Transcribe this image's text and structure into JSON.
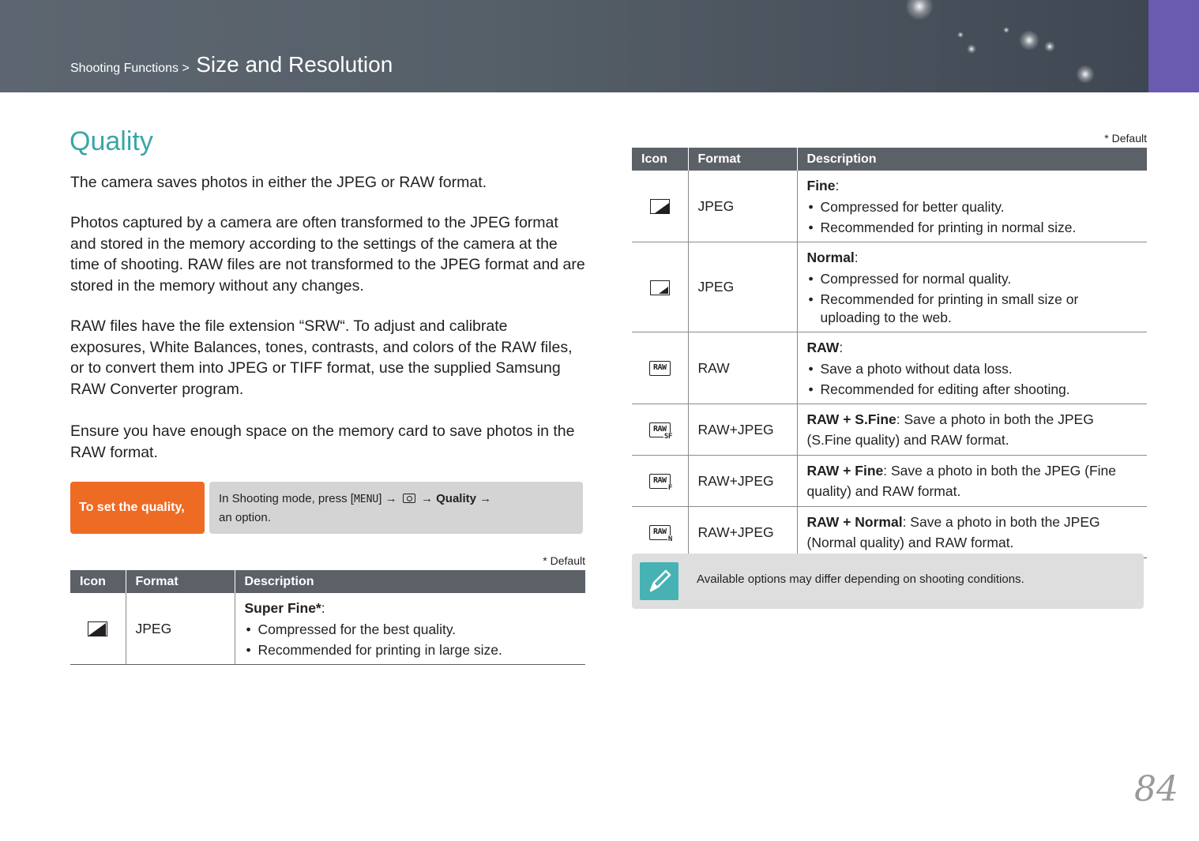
{
  "header": {
    "breadcrumb_parent": "Shooting Functions",
    "breadcrumb_sep": ">",
    "breadcrumb_current": "Size and Resolution"
  },
  "section": {
    "title": "Quality",
    "paragraphs": [
      "The camera saves photos in either the JPEG or RAW format.",
      "Photos captured by a camera are often transformed to the JPEG format and stored in the memory according to the settings of the camera at the time of shooting. RAW files are not transformed to the JPEG format and are stored in the memory without any changes.",
      "RAW files have the file extension “SRW“. To adjust and calibrate exposures, White Balances, tones, contrasts, and colors of the RAW files, or to convert them into JPEG or TIFF format, use the supplied Samsung RAW Converter program.",
      "Ensure you have enough space on the memory card to save photos in the RAW format."
    ]
  },
  "howto": {
    "label": "To set the quality,",
    "instr_prefix": "In Shooting mode, press [",
    "menu_key": "MENU",
    "instr_mid": "] →",
    "arrow2": "→",
    "quality": "Quality",
    "arrow3": "→",
    "instr_end": "an option."
  },
  "default_note": "* Default",
  "table_headers": {
    "icon": "Icon",
    "format": "Format",
    "description": "Description"
  },
  "table_left": [
    {
      "icon": "super-fine-icon",
      "format": "JPEG",
      "name": "Super Fine*",
      "bullets": [
        "Compressed for the best quality.",
        "Recommended for printing in large size."
      ]
    }
  ],
  "table_right": [
    {
      "icon": "fine-icon",
      "format": "JPEG",
      "name": "Fine",
      "bullets": [
        "Compressed for better quality.",
        "Recommended for printing in normal size."
      ]
    },
    {
      "icon": "normal-icon",
      "format": "JPEG",
      "name": "Normal",
      "bullets": [
        "Compressed for normal quality.",
        "Recommended for printing in small size or uploading to the web."
      ]
    },
    {
      "icon": "raw-icon",
      "format": "RAW",
      "name": "RAW",
      "bullets": [
        "Save a photo without data loss.",
        "Recommended for editing after shooting."
      ]
    },
    {
      "icon": "raw-sfine-icon",
      "format": "RAW+JPEG",
      "name": "RAW + S.Fine",
      "text": ": Save a photo in both the JPEG (S.Fine quality) and RAW format."
    },
    {
      "icon": "raw-fine-icon",
      "format": "RAW+JPEG",
      "name": "RAW + Fine",
      "text": ": Save a photo in both the JPEG (Fine quality) and RAW format."
    },
    {
      "icon": "raw-normal-icon",
      "format": "RAW+JPEG",
      "name": "RAW + Normal",
      "text": ": Save a photo in both the JPEG (Normal quality) and RAW format."
    }
  ],
  "icon_texts": {
    "raw": "RAW",
    "sf": "SF",
    "f": "F",
    "n": "N"
  },
  "note": {
    "text": "Available options may differ depending on shooting conditions."
  },
  "page_number": "84",
  "colors": {
    "accent_teal": "#3aa6a8",
    "orange": "#ee6b24",
    "purple": "#6b5bb0",
    "table_header": "#5c6168"
  }
}
